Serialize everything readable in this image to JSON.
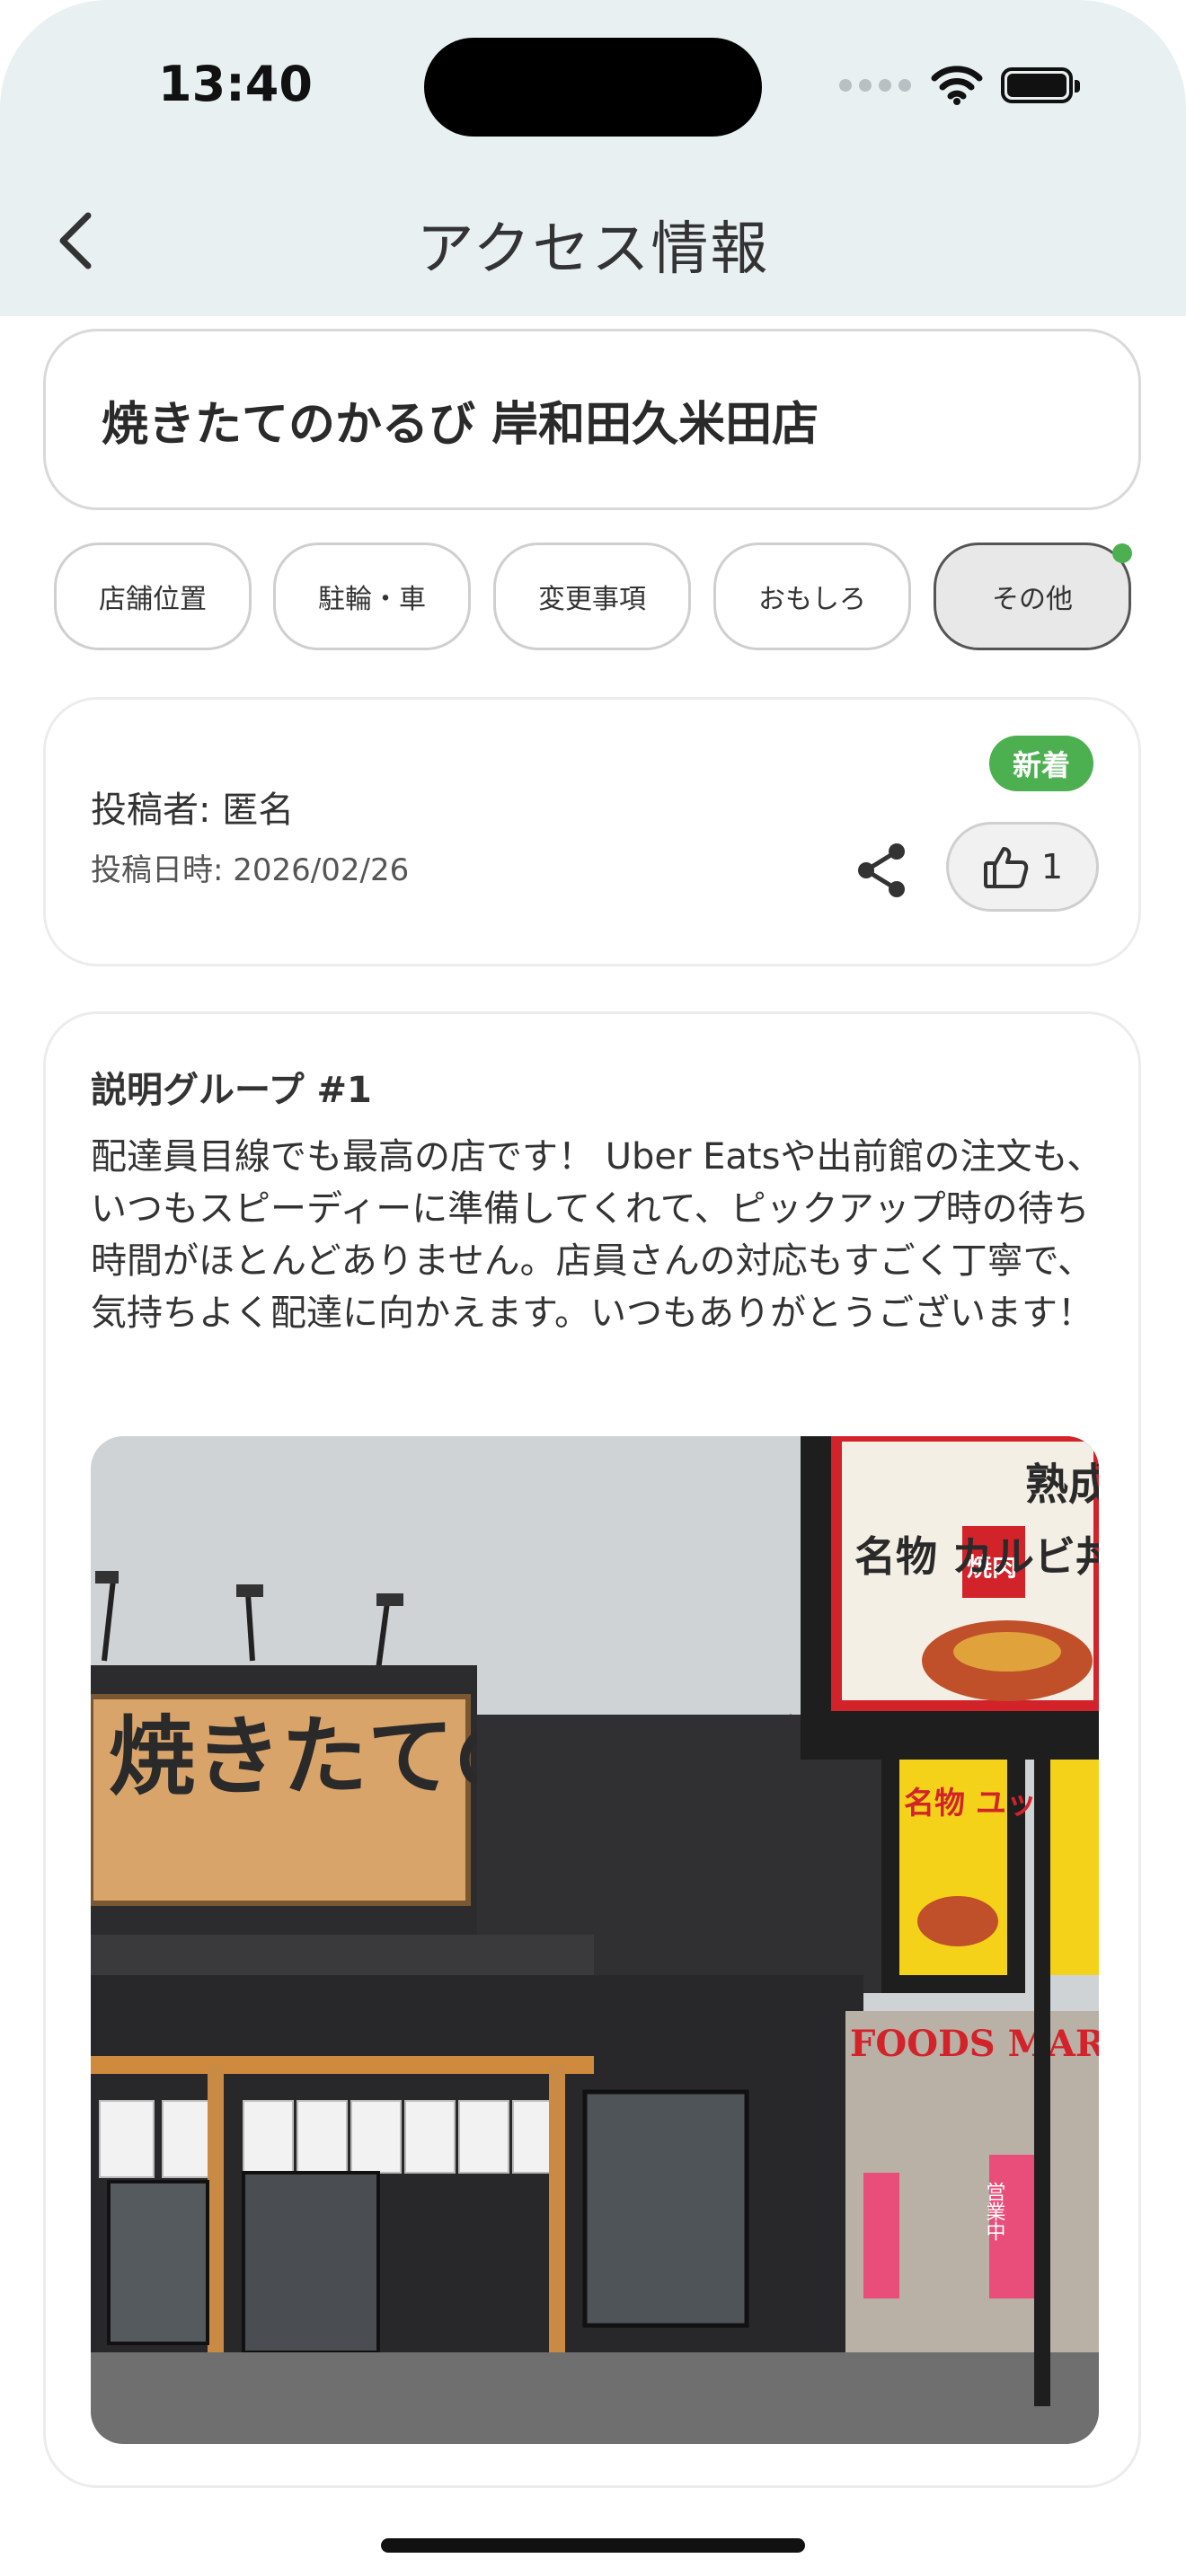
{
  "status_bar": {
    "time": "13:40"
  },
  "nav": {
    "title": "アクセス情報",
    "back_icon": "chevron-left-icon"
  },
  "store": {
    "name": "焼きたてのかるび 岸和田久米田店"
  },
  "tabs": [
    {
      "label": "店舗位置",
      "active": false
    },
    {
      "label": "駐輪・車",
      "active": false
    },
    {
      "label": "変更事項",
      "active": false
    },
    {
      "label": "おもしろ",
      "active": false
    },
    {
      "label": "その他",
      "active": true
    }
  ],
  "post": {
    "author": "投稿者: 匿名",
    "date": "投稿日時: 2026/02/26",
    "badge": "新着",
    "like_count": "1",
    "accent_color": "#4caf50"
  },
  "description": {
    "group_title": "説明グループ #1",
    "text": "配達員目線でも最高の店です！ Uber Eatsや出前館の注文も、いつもスピーディーに準備してくれて、ピックアップ時の待ち時間がほとんどありません。店員さんの対応もすごく丁寧で、気持ちよく配達に向かえます。いつもありがとうございます！"
  },
  "photo": {
    "sign_main": "焼きたてのかるび",
    "sign_menu_top": "熟成",
    "sign_menu_mid": "焼肉",
    "sign_menu_name": "名物 カルビ丼",
    "sign_soup": "名物 ユッケジャン スープ",
    "market_sign": "FOODS MARKET",
    "banner": "営業中"
  }
}
